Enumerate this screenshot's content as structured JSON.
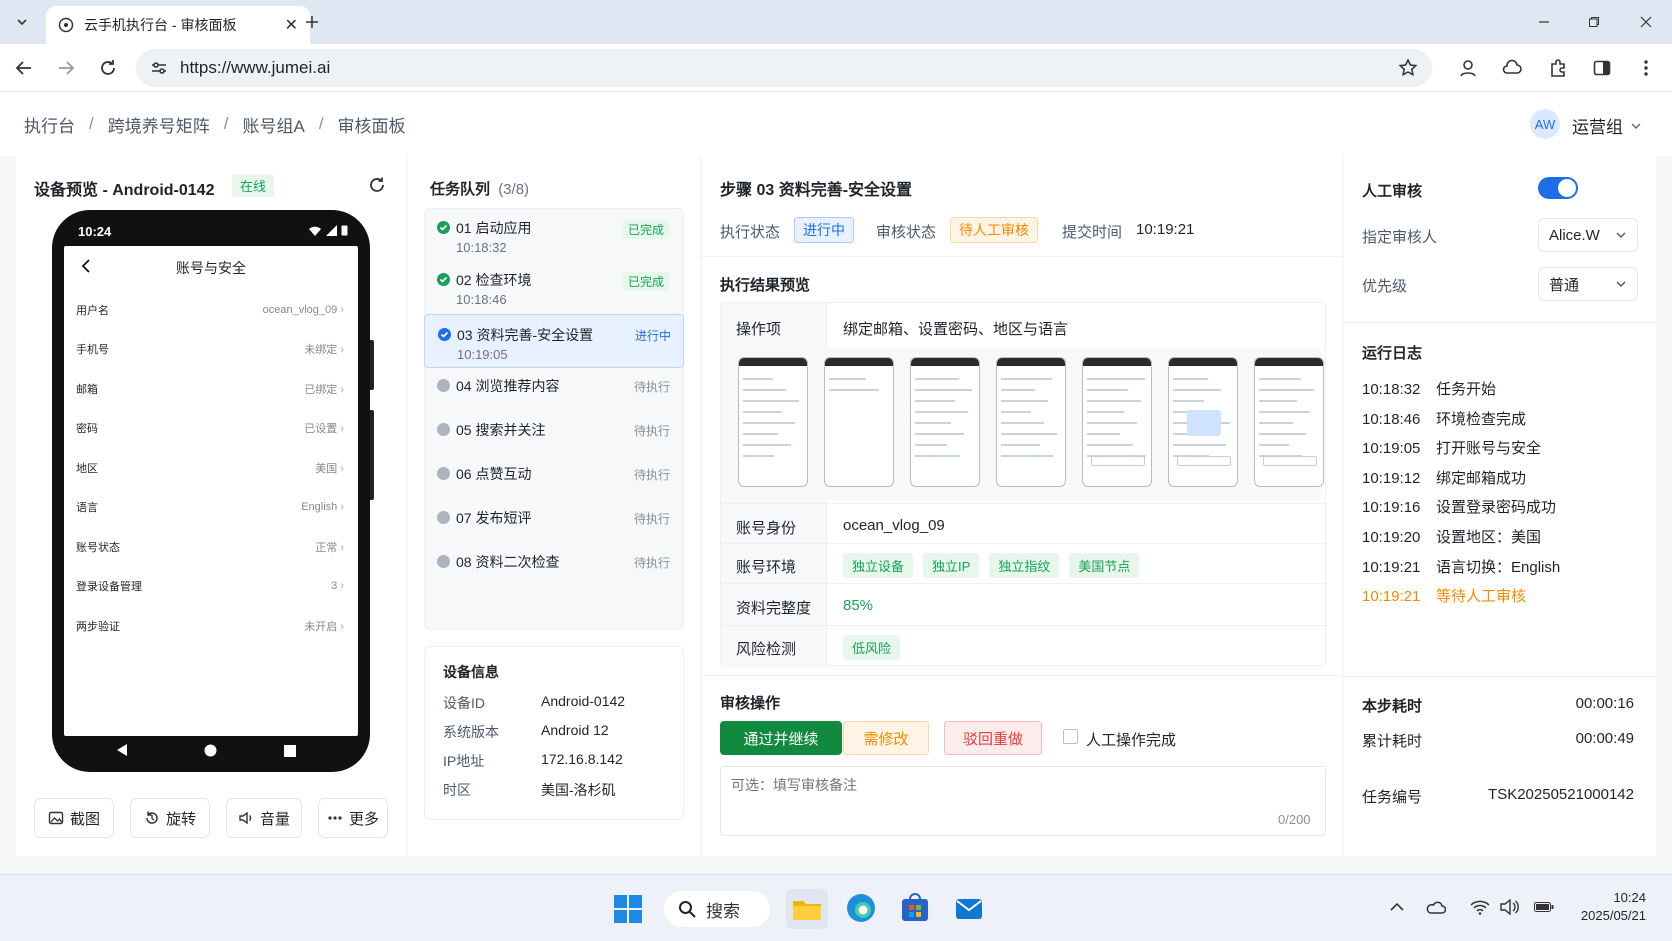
{
  "browser": {
    "tab_title": "云手机执行台 - 审核面板",
    "url": "https://www.jumei.ai"
  },
  "breadcrumb": [
    "执行台",
    "跨境养号矩阵",
    "账号组A",
    "审核面板"
  ],
  "user": {
    "initials": "AW",
    "group": "运营组"
  },
  "device_preview": {
    "title": "设备预览 - Android-0142",
    "status": "在线",
    "phone_time": "10:24",
    "screen_title": "账号与安全",
    "rows": [
      {
        "label": "用户名",
        "value": "ocean_vlog_09"
      },
      {
        "label": "手机号",
        "value": "未绑定"
      },
      {
        "label": "邮箱",
        "value": "已绑定"
      },
      {
        "label": "密码",
        "value": "已设置"
      },
      {
        "label": "地区",
        "value": "美国"
      },
      {
        "label": "语言",
        "value": "English"
      },
      {
        "label": "账号状态",
        "value": "正常"
      },
      {
        "label": "登录设备管理",
        "value": "3"
      },
      {
        "label": "两步验证",
        "value": "未开启"
      }
    ],
    "buttons": {
      "screenshot": "截图",
      "rotate": "旋转",
      "volume": "音量",
      "more": "更多"
    }
  },
  "task_queue": {
    "title": "任务队列",
    "count": "(3/8)",
    "tasks": [
      {
        "name": "01  启动应用",
        "time": "10:18:32",
        "status": "已完成"
      },
      {
        "name": "02  检查环境",
        "time": "10:18:46",
        "status": "已完成"
      },
      {
        "name": "03  资料完善-安全设置",
        "time": "10:19:05",
        "status": "进行中"
      },
      {
        "name": "04  浏览推荐内容",
        "status": "待执行"
      },
      {
        "name": "05  搜索并关注",
        "status": "待执行"
      },
      {
        "name": "06  点赞互动",
        "status": "待执行"
      },
      {
        "name": "07  发布短评",
        "status": "待执行"
      },
      {
        "name": "08  资料二次检查",
        "status": "待执行"
      }
    ]
  },
  "device_info": {
    "title": "设备信息",
    "rows": [
      {
        "label": "设备ID",
        "value": "Android-0142"
      },
      {
        "label": "系统版本",
        "value": "Android 12"
      },
      {
        "label": "IP地址",
        "value": "172.16.8.142"
      },
      {
        "label": "时区",
        "value": "美国-洛杉矶"
      }
    ]
  },
  "step": {
    "title": "步骤 03  资料完善-安全设置",
    "exec_label": "执行状态",
    "exec_status": "进行中",
    "review_label": "审核状态",
    "review_status": "待人工审核",
    "submit_label": "提交时间",
    "submit_time": "10:19:21"
  },
  "result": {
    "title": "执行结果预览",
    "op_label": "操作项",
    "op_value": "绑定邮箱、设置密码、地区与语言",
    "identity_label": "账号身份",
    "identity_value": "ocean_vlog_09",
    "env_label": "账号环境",
    "env_tags": [
      "独立设备",
      "独立IP",
      "独立指纹",
      "美国节点"
    ],
    "complete_label": "资料完整度",
    "complete_value": "85%",
    "risk_label": "风险检测",
    "risk_value": "低风险"
  },
  "review_ops": {
    "title": "审核操作",
    "approve": "通过并继续",
    "modify": "需修改",
    "reject": "驳回重做",
    "manual_done": "人工操作完成",
    "note_placeholder": "可选：填写审核备注",
    "counter": "0/200"
  },
  "manual_review": {
    "title": "人工审核",
    "enabled": true,
    "reviewer_label": "指定审核人",
    "reviewer": "Alice.W",
    "priority_label": "优先级",
    "priority": "普通"
  },
  "log": {
    "title": "运行日志",
    "entries": [
      {
        "time": "10:18:32",
        "text": "任务开始"
      },
      {
        "time": "10:18:46",
        "text": "环境检查完成"
      },
      {
        "time": "10:19:05",
        "text": "打开账号与安全"
      },
      {
        "time": "10:19:12",
        "text": "绑定邮箱成功"
      },
      {
        "time": "10:19:16",
        "text": "设置登录密码成功"
      },
      {
        "time": "10:19:20",
        "text": "设置地区：美国"
      },
      {
        "time": "10:19:21",
        "text": "语言切换：English"
      },
      {
        "time": "10:19:21",
        "text": "等待人工审核"
      }
    ]
  },
  "timing": {
    "step_label": "本步耗时",
    "step_value": "00:00:16",
    "total_label": "累计耗时",
    "total_value": "00:00:49",
    "task_id_label": "任务编号",
    "task_id": "TSK20250521000142"
  },
  "taskbar": {
    "search": "搜索",
    "time": "10:24",
    "date": "2025/05/21"
  },
  "colors": {
    "primary": "#1e6fe6",
    "success": "#18a058",
    "warning": "#f08c00",
    "danger": "#e03e3e",
    "approve_btn": "#0f8a3e"
  }
}
